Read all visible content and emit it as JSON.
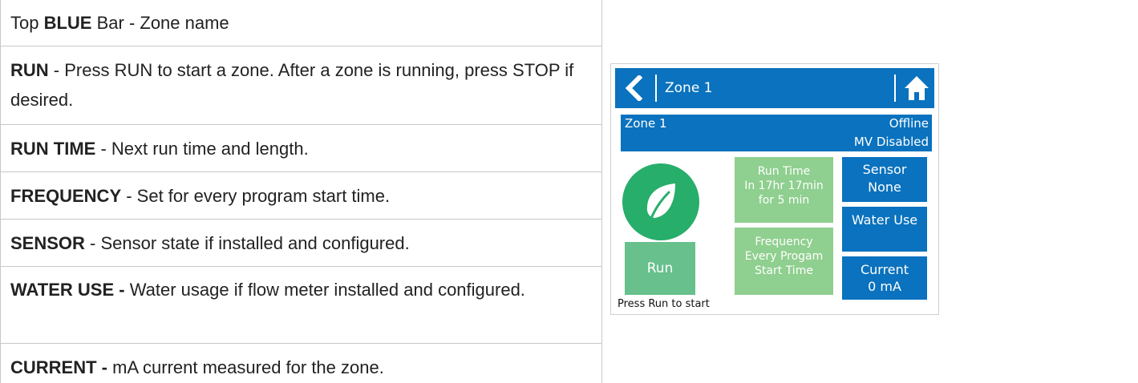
{
  "doc": {
    "rows": [
      {
        "label": "",
        "pre": "Top ",
        "bold": "BLUE",
        "post": " Bar - Zone name"
      },
      {
        "label": "RUN",
        "text": " - Press RUN to start a zone. After a zone is running, press STOP if desired."
      },
      {
        "label": "RUN TIME",
        "text": " - Next run time and length."
      },
      {
        "label": "FREQUENCY",
        "text": " - Set for every program start time."
      },
      {
        "label": "SENSOR",
        "text": " - Sensor state if installed and configured."
      },
      {
        "label": "WATER USE -",
        "text": " Water usage if flow meter installed and configured."
      },
      {
        "label": "CURRENT -",
        "text": " mA current measured for the zone."
      }
    ]
  },
  "device": {
    "topbar": {
      "title": "Zone 1",
      "back_icon": "chevron-left-icon",
      "home_icon": "home-icon"
    },
    "status": {
      "zone": "Zone 1",
      "connection": "Offline",
      "mv": "MV Disabled"
    },
    "run_label": "Run",
    "run_time": {
      "line1": "Run Time",
      "line2": "In 17hr 17min",
      "line3": "for 5 min"
    },
    "frequency": {
      "line1": "Frequency",
      "line2": "Every Progam",
      "line3": "Start Time"
    },
    "sensor": {
      "line1": "Sensor",
      "line2": "None"
    },
    "water_use": "Water Use",
    "current": {
      "line1": "Current",
      "line2": "0 mA"
    },
    "footer": "Press Run to start",
    "colors": {
      "blue": "#0a72be",
      "green": "#27ae6a",
      "light_green": "#8fcf8f",
      "run_green": "#68c08c"
    }
  }
}
